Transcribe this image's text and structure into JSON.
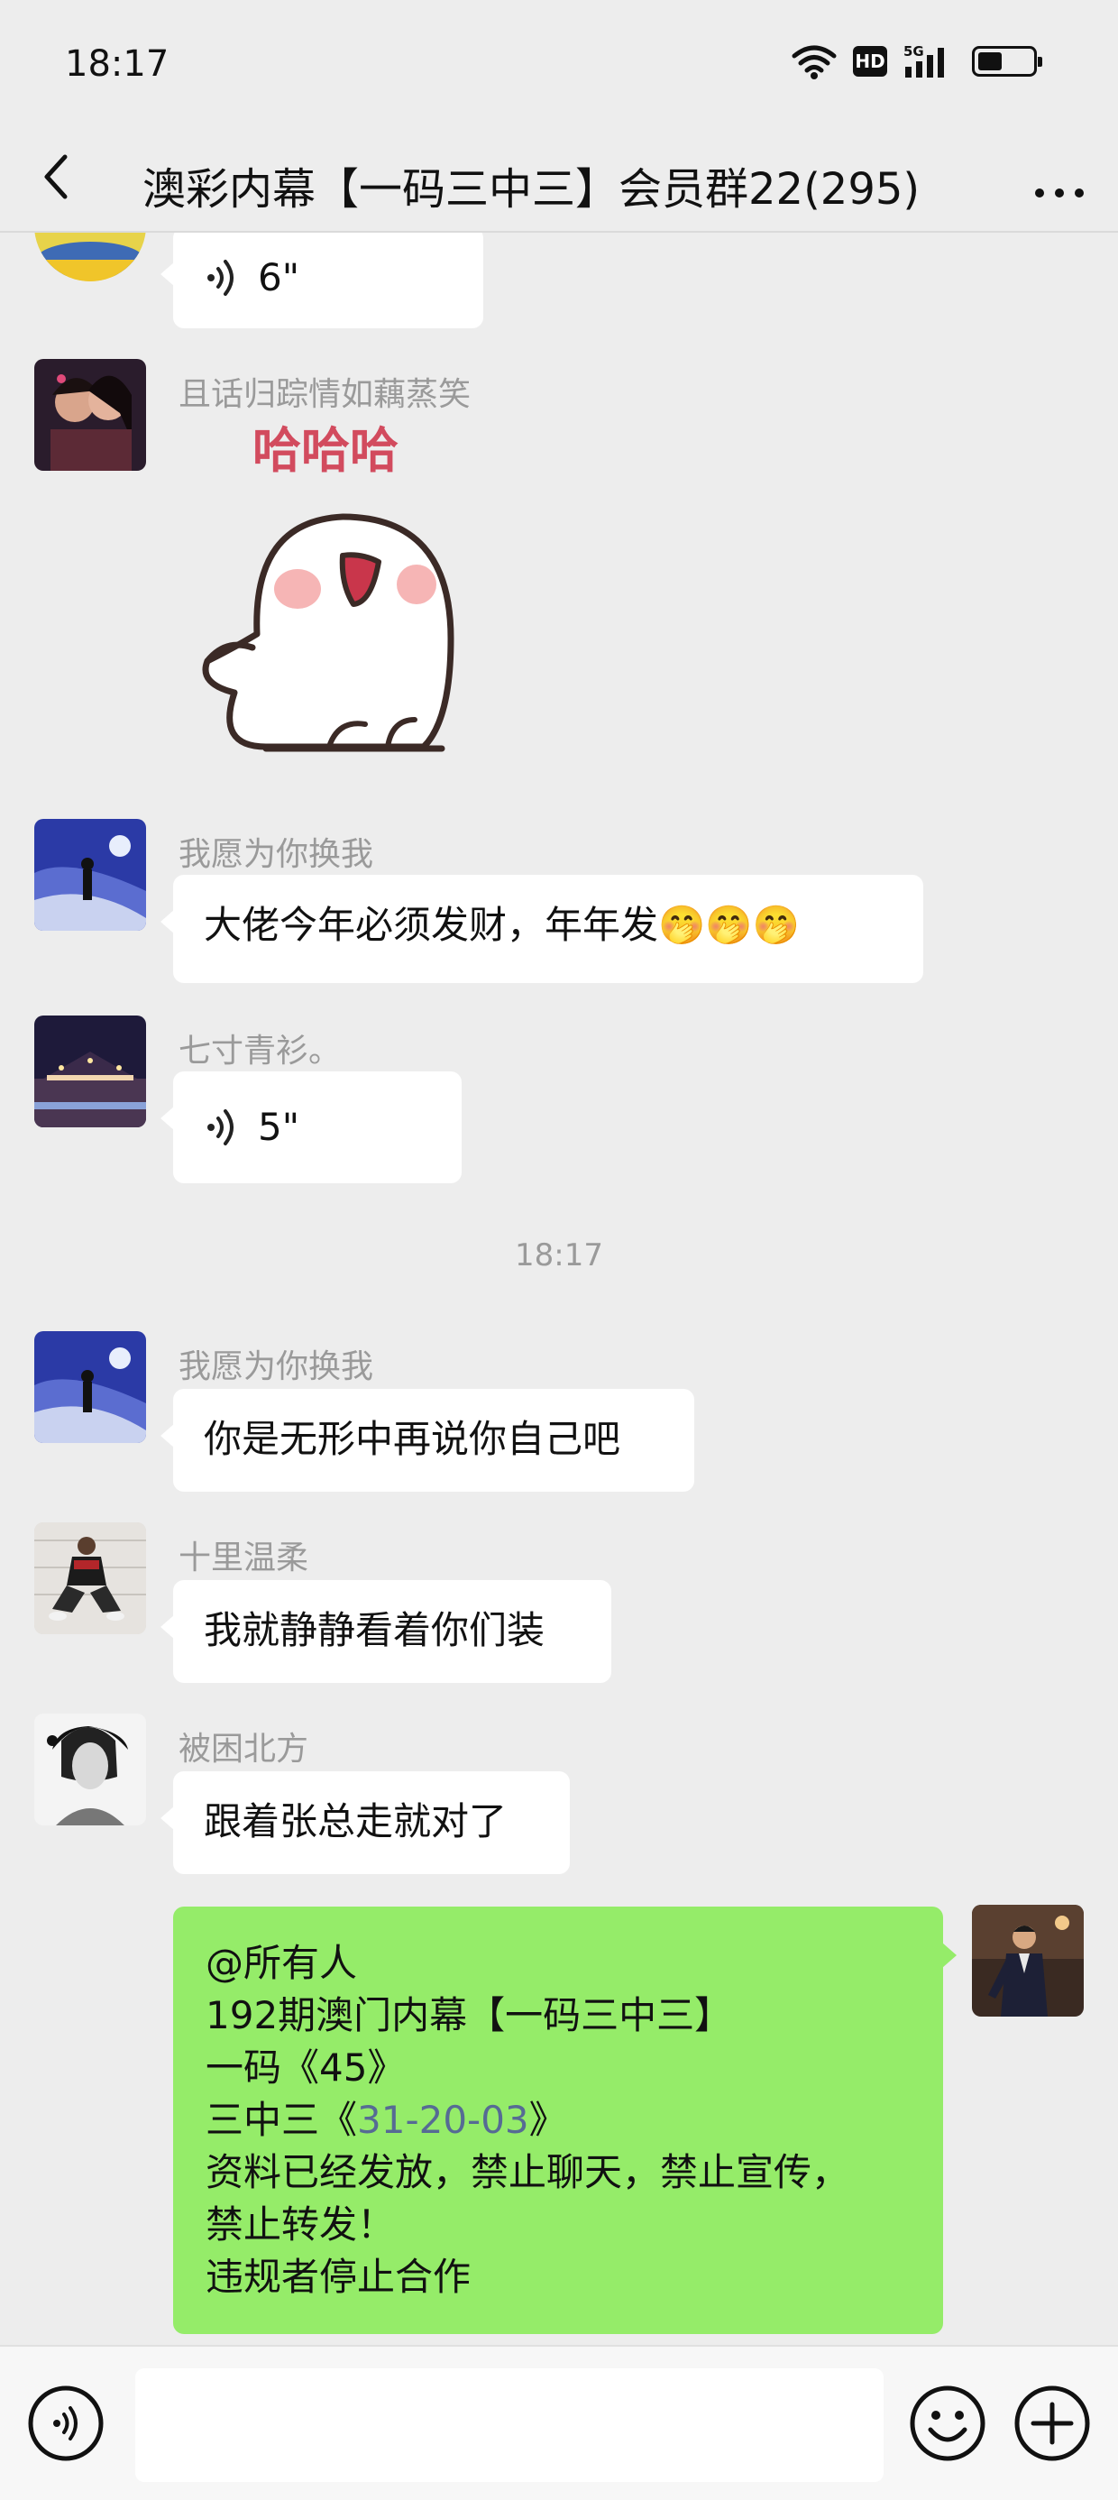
{
  "status_bar": {
    "time": "18:17",
    "hd": "HD",
    "network": "5G",
    "battery_level": 0.45
  },
  "nav": {
    "title": "澳彩内幕【一码三中三】会员群22(295)",
    "back_icon": "chevron-left-icon",
    "more_icon": "more-dots-icon"
  },
  "messages": [
    {
      "type": "voice",
      "duration": "6\""
    },
    {
      "sender": "且话归踪情如藕蒸笑",
      "type": "sticker",
      "sticker_text": "哈哈哈"
    },
    {
      "sender": "我愿为你换我",
      "type": "text",
      "text": "大佬今年必须发财，年年发🤭🤭🤭"
    },
    {
      "sender": "七寸青衫。",
      "type": "voice",
      "duration": "5\""
    },
    {
      "type": "time",
      "text": "18:17"
    },
    {
      "sender": "我愿为你换我",
      "type": "text",
      "text": "你是无形中再说你自己吧"
    },
    {
      "sender": "十里温柔",
      "type": "text",
      "text": "我就静静看着你们装"
    },
    {
      "sender": "被困北方",
      "type": "text",
      "text": "跟着张总走就对了"
    }
  ],
  "my_message": {
    "line1": "@所有人",
    "line2": "192期澳门内幕【一码三中三】",
    "line3": "一码《45》",
    "line4_prefix": "三中三《",
    "line4_number": "31-20-03",
    "line4_suffix": "》",
    "line5": "资料已经发放，禁止聊天，禁止宣传，",
    "line6": "禁止转发！",
    "line7": "违规者停止合作"
  },
  "input_bar": {
    "voice_icon": "voice-input-icon",
    "emoji_icon": "emoji-icon",
    "plus_icon": "plus-icon"
  },
  "colors": {
    "background": "#ededed",
    "my_bubble": "#95ec69",
    "other_bubble": "#ffffff",
    "link": "#566b94"
  }
}
